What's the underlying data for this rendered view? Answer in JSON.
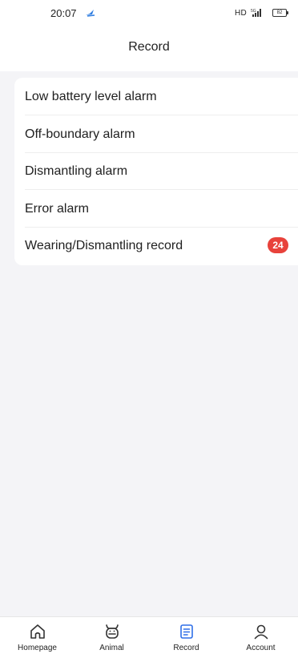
{
  "status_bar": {
    "time": "20:07",
    "network_label": "HD",
    "signal_label": "5G",
    "battery_level": "82"
  },
  "header": {
    "title": "Record"
  },
  "records": [
    {
      "label": "Low battery level alarm",
      "badge": null
    },
    {
      "label": "Off-boundary alarm",
      "badge": null
    },
    {
      "label": "Dismantling alarm",
      "badge": null
    },
    {
      "label": "Error alarm",
      "badge": null
    },
    {
      "label": "Wearing/Dismantling record",
      "badge": "24"
    }
  ],
  "tab_bar": {
    "tabs": [
      {
        "label": "Homepage",
        "icon": "home-icon",
        "active": false
      },
      {
        "label": "Animal",
        "icon": "animal-icon",
        "active": false
      },
      {
        "label": "Record",
        "icon": "record-icon",
        "active": true
      },
      {
        "label": "Account",
        "icon": "account-icon",
        "active": false
      }
    ]
  },
  "colors": {
    "accent": "#2f6fe8",
    "badge": "#e8423b",
    "background": "#f4f4f7"
  }
}
